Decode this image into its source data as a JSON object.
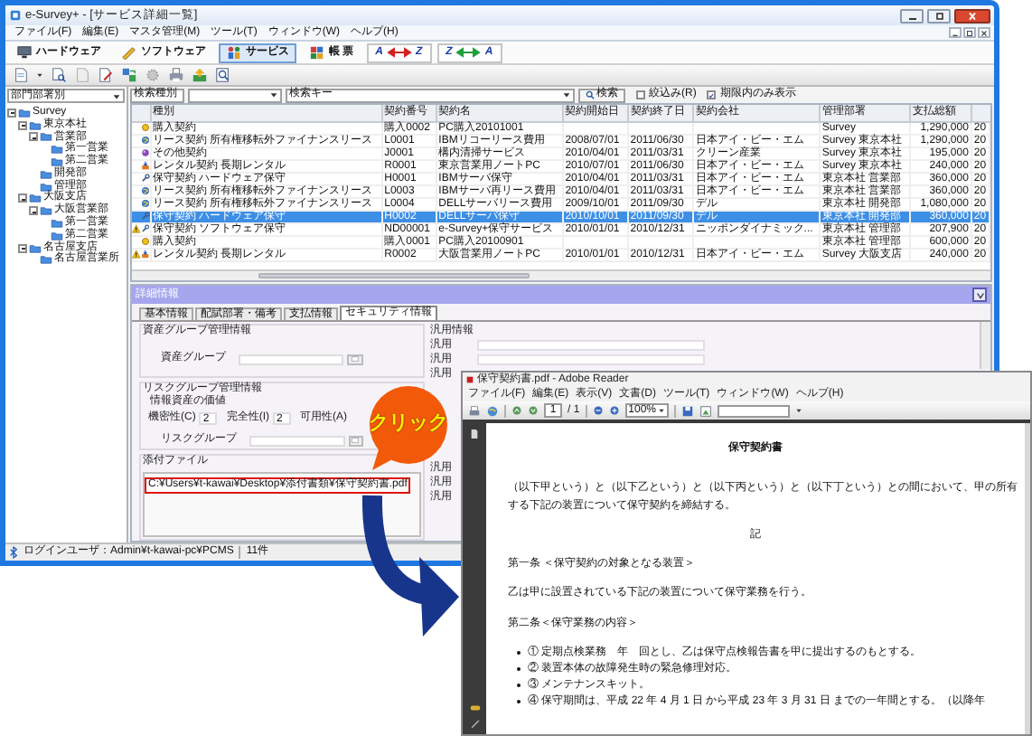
{
  "main_window": {
    "title": "e-Survey+ - [サービス詳細一覧]",
    "menu": [
      "ファイル(F)",
      "編集(E)",
      "マスタ管理(M)",
      "ツール(T)",
      "ウィンドウ(W)",
      "ヘルプ(H)"
    ]
  },
  "view_tabs": [
    {
      "kind": "hardware",
      "label": "ハードウェア",
      "selected": false
    },
    {
      "kind": "software",
      "label": "ソフトウェア",
      "selected": false
    },
    {
      "kind": "service",
      "label": "サービス",
      "selected": true
    },
    {
      "kind": "report",
      "label": "帳 票",
      "selected": false
    }
  ],
  "sort_buttons": [
    {
      "from": "A",
      "to": "Z",
      "color": "#d42020"
    },
    {
      "from": "Z",
      "to": "A",
      "color": "#1e9e3a"
    }
  ],
  "sidebar": {
    "dropdown": "部門部署別",
    "tree": [
      {
        "label": "Survey",
        "expanded": true,
        "children": [
          {
            "label": "東京本社",
            "expanded": true,
            "children": [
              {
                "label": "営業部",
                "expanded": true,
                "children": [
                  {
                    "label": "第一営業"
                  },
                  {
                    "label": "第二営業"
                  }
                ]
              },
              {
                "label": "開発部"
              },
              {
                "label": "管理部"
              }
            ]
          },
          {
            "label": "大阪支店",
            "expanded": true,
            "children": [
              {
                "label": "大阪営業部",
                "expanded": true,
                "children": [
                  {
                    "label": "第一営業"
                  },
                  {
                    "label": "第二営業"
                  }
                ]
              }
            ]
          },
          {
            "label": "名古屋支店",
            "expanded": true,
            "children": [
              {
                "label": "名古屋営業所"
              }
            ]
          }
        ]
      }
    ]
  },
  "search": {
    "type_dropdown": "検索種別",
    "key_field": "検索キー",
    "button": "検索",
    "checkboxes": [
      {
        "label": "絞込み(R)",
        "checked": false
      },
      {
        "label": "期限内のみ表示",
        "checked": true
      }
    ]
  },
  "table": {
    "columns": [
      "種別",
      "契約番号",
      "契約名",
      "契約開始日",
      "契約終了日",
      "契約会社",
      "管理部署",
      "支払総額"
    ],
    "rows": [
      {
        "kind": "purchase",
        "warning": false,
        "selected": false,
        "cells": [
          "購入契約",
          "購入0002",
          "PC購入20101001",
          null,
          null,
          null,
          "Survey",
          "1,290,000",
          "20"
        ]
      },
      {
        "kind": "lease",
        "warning": false,
        "selected": false,
        "cells": [
          "リース契約 所有権移転外ファイナンスリース",
          "L0001",
          "IBMリコーリース費用",
          "2008/07/01",
          "2011/06/30",
          "日本アイ・ビー・エム",
          "Survey 東京本社",
          "1,290,000",
          "20"
        ]
      },
      {
        "kind": "other",
        "warning": false,
        "selected": false,
        "cells": [
          "その他契約",
          "J0001",
          "構内清掃サービス",
          "2010/04/01",
          "2011/03/31",
          "クリーン産業",
          "Survey 東京本社",
          "195,000",
          "20"
        ]
      },
      {
        "kind": "rental",
        "warning": false,
        "selected": false,
        "cells": [
          "レンタル契約 長期レンタル",
          "R0001",
          "東京営業用ノートPC",
          "2010/07/01",
          "2011/06/30",
          "日本アイ・ビー・エム",
          "Survey 東京本社",
          "240,000",
          "20"
        ]
      },
      {
        "kind": "maintenance",
        "warning": false,
        "selected": false,
        "cells": [
          "保守契約 ハードウェア保守",
          "H0001",
          "IBMサーバ保守",
          "2010/04/01",
          "2011/03/31",
          "日本アイ・ビー・エム",
          "東京本社 営業部",
          "360,000",
          "20"
        ]
      },
      {
        "kind": "lease",
        "warning": false,
        "selected": false,
        "cells": [
          "リース契約 所有権移転外ファイナンスリース",
          "L0003",
          "IBMサーバ再リース費用",
          "2010/04/01",
          "2011/03/31",
          "日本アイ・ビー・エム",
          "東京本社 営業部",
          "360,000",
          "20"
        ]
      },
      {
        "kind": "lease",
        "warning": false,
        "selected": false,
        "cells": [
          "リース契約 所有権移転外ファイナンスリース",
          "L0004",
          "DELLサーバリース費用",
          "2009/10/01",
          "2011/09/30",
          "デル",
          "東京本社 開発部",
          "1,080,000",
          "20"
        ]
      },
      {
        "kind": "maintenance",
        "warning": false,
        "selected": true,
        "cells": [
          "保守契約 ハードウェア保守",
          "H0002",
          "DELLサーバ保守",
          "2010/10/01",
          "2011/09/30",
          "デル",
          "東京本社 開発部",
          "360,000",
          "20"
        ]
      },
      {
        "kind": "maintenance",
        "warning": true,
        "selected": false,
        "cells": [
          "保守契約 ソフトウェア保守",
          "ND00001",
          "e-Survey+保守サービス",
          "2010/01/01",
          "2010/12/31",
          "ニッポンダイナミック...",
          "東京本社 管理部",
          "207,900",
          "20"
        ]
      },
      {
        "kind": "purchase",
        "warning": false,
        "selected": false,
        "cells": [
          "購入契約",
          "購入0001",
          "PC購入20100901",
          null,
          null,
          null,
          "東京本社 管理部",
          "600,000",
          "20"
        ]
      },
      {
        "kind": "rental",
        "warning": true,
        "selected": false,
        "cells": [
          "レンタル契約 長期レンタル",
          "R0002",
          "大阪営業用ノートPC",
          "2010/01/01",
          "2010/12/31",
          "日本アイ・ビー・エム",
          "Survey 大阪支店",
          "240,000",
          "20"
        ]
      }
    ]
  },
  "detail": {
    "title": "詳細情報",
    "tabs": [
      {
        "label": "基本情報",
        "selected": false
      },
      {
        "label": "配賦部署・備考",
        "selected": false
      },
      {
        "label": "支払情報",
        "selected": false
      },
      {
        "label": "セキュリティ情報",
        "selected": true
      }
    ],
    "asset_group": {
      "title": "資産グループ管理情報",
      "label": "資産グループ"
    },
    "risk_group": {
      "title": "リスクグループ管理情報",
      "subtitle": "情報資産の価値",
      "ratings": [
        {
          "label": "機密性(C)",
          "value": "2"
        },
        {
          "label": "完全性(I)",
          "value": "2"
        },
        {
          "label": "可用性(A)"
        }
      ],
      "group_label": "リスクグループ"
    },
    "attachments": {
      "title": "添付ファイル",
      "files": [
        "C:¥Users¥t-kawai¥Desktop¥添付書類¥保守契約書.pdf"
      ]
    },
    "general_info": {
      "title": "汎用情報",
      "rows_upper": [
        {
          "label": "汎用",
          "field": true
        },
        {
          "label": "汎用",
          "field": true
        },
        {
          "label": "汎用",
          "field": false
        }
      ],
      "rows_lower": [
        {
          "label": "汎用",
          "field": false
        },
        {
          "label": "汎用",
          "field": false
        },
        {
          "label": "汎用",
          "field": false
        }
      ]
    }
  },
  "status_bar": {
    "user": "ログインユーザ：Admin¥t-kawai-pc¥PCMS",
    "count": "11件"
  },
  "callout": {
    "text": "クリック"
  },
  "pdf_window": {
    "title": "保守契約書.pdf - Adobe Reader",
    "menu": [
      "ファイル(F)",
      "編集(E)",
      "表示(V)",
      "文書(D)",
      "ツール(T)",
      "ウィンドウ(W)",
      "ヘルプ(H)"
    ],
    "page": "1",
    "page_count": "/ 1",
    "zoom": "100%",
    "document": [
      {
        "kind": "title",
        "text": "保守契約書"
      },
      {
        "kind": "paragraph",
        "text": "（以下甲という）と（以下乙という）と（以下丙という）と（以下丁という）との間において、甲の所有する下記の装置について保守契約を締結する。"
      },
      {
        "kind": "center",
        "text": "記"
      },
      {
        "kind": "heading",
        "text": "第一条 ＜保守契約の対象となる装置＞"
      },
      {
        "kind": "paragraph",
        "text": "乙は甲に設置されている下記の装置について保守業務を行う。"
      },
      {
        "kind": "heading",
        "text": "第二条＜保守業務の内容＞"
      },
      {
        "kind": "bullet",
        "text": "① 定期点検業務　年　回とし、乙は保守点検報告書を甲に提出するのもとする。"
      },
      {
        "kind": "bullet",
        "text": "② 装置本体の故障発生時の緊急修理対応。"
      },
      {
        "kind": "bullet",
        "text": "③ メンテナンスキット。"
      },
      {
        "kind": "bullet",
        "text": "④ 保守期間は、平成 22 年 4 月 1 日 から平成 23 年 3 月 31 日 までの一年間とする。（以降年"
      }
    ]
  }
}
